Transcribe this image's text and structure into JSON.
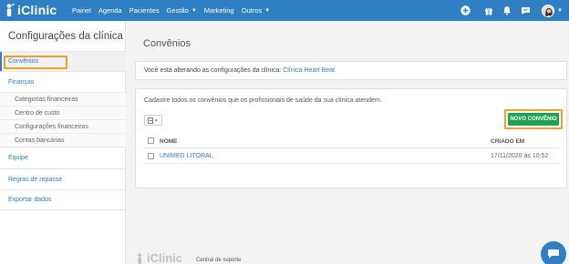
{
  "brand": {
    "name": "iClinic"
  },
  "nav": {
    "items": [
      {
        "label": "Painel"
      },
      {
        "label": "Agenda"
      },
      {
        "label": "Pacientes"
      },
      {
        "label": "Gestão"
      },
      {
        "label": "Marketing"
      },
      {
        "label": "Outros"
      }
    ]
  },
  "sidebar": {
    "title": "Configurações da clínica",
    "items": {
      "convenios": "Convênios",
      "financas": "Finanças",
      "sub": [
        "Categorias financeiras",
        "Centro de custo",
        "Configurações financeiras",
        "Contas bancárias"
      ],
      "equipe": "Equipe",
      "regras": "Regras de repasse",
      "exportar": "Exportar dados"
    }
  },
  "main": {
    "title": "Convênios",
    "info_prefix": "Você está alterando as configurações da clínica:",
    "clinic_name": "Clínica Heart Beat",
    "description": "Cadastre todos os convênios que os profissionais de saúde da sua clínica atendem.",
    "new_button": "NOVO CONVÊNIO",
    "table": {
      "headers": {
        "name": "NOME",
        "created": "CRIADO EM"
      },
      "rows": [
        {
          "name": "UNIMED LITORAL",
          "created": "17/11/2020 às 10:52"
        }
      ]
    }
  },
  "footer": {
    "brand": "iClinic",
    "support": "Central de suporte"
  },
  "colors": {
    "primary": "#2e7fc4",
    "success": "#1fa24f",
    "highlight": "#f0a029"
  }
}
